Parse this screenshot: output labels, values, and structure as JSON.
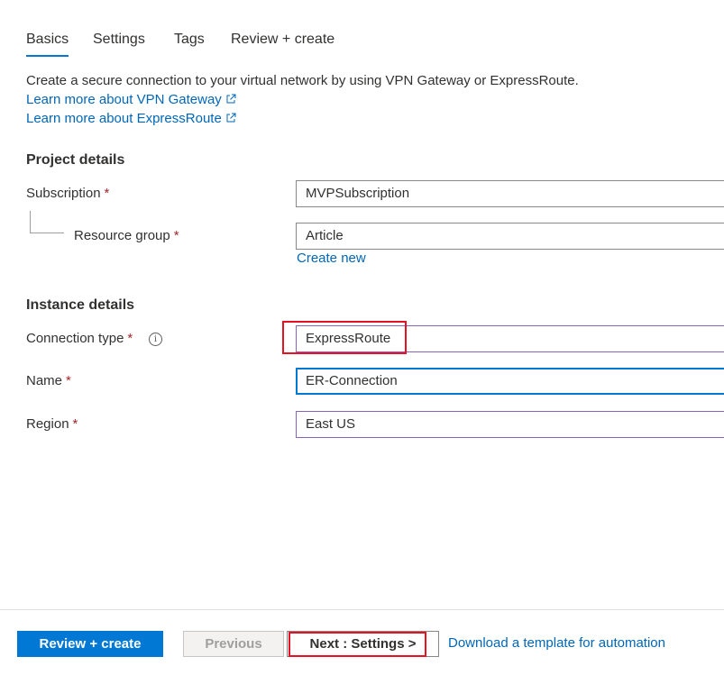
{
  "tabs": [
    {
      "label": "Basics",
      "active": true
    },
    {
      "label": "Settings",
      "active": false
    },
    {
      "label": "Tags",
      "active": false
    },
    {
      "label": "Review + create",
      "active": false
    }
  ],
  "intro": {
    "description": "Create a secure connection to your virtual network by using VPN Gateway or ExpressRoute.",
    "link_vpn": "Learn more about VPN Gateway",
    "link_er": "Learn more about ExpressRoute"
  },
  "project_details": {
    "title": "Project details",
    "subscription_label": "Subscription",
    "subscription_value": "MVPSubscription",
    "resource_group_label": "Resource group",
    "resource_group_value": "Article",
    "create_new": "Create new"
  },
  "instance_details": {
    "title": "Instance details",
    "connection_type_label": "Connection type",
    "connection_type_value": "ExpressRoute",
    "name_label": "Name",
    "name_value": "ER-Connection",
    "region_label": "Region",
    "region_value": "East US"
  },
  "required_marker": "*",
  "info_glyph": "i",
  "footer": {
    "review_create": "Review + create",
    "previous": "Previous",
    "next": "Next : Settings >",
    "download_template": "Download a template for automation"
  },
  "colors": {
    "accent": "#0078d4",
    "link": "#0067b8",
    "required": "#a4262c",
    "highlight": "#e81123"
  }
}
